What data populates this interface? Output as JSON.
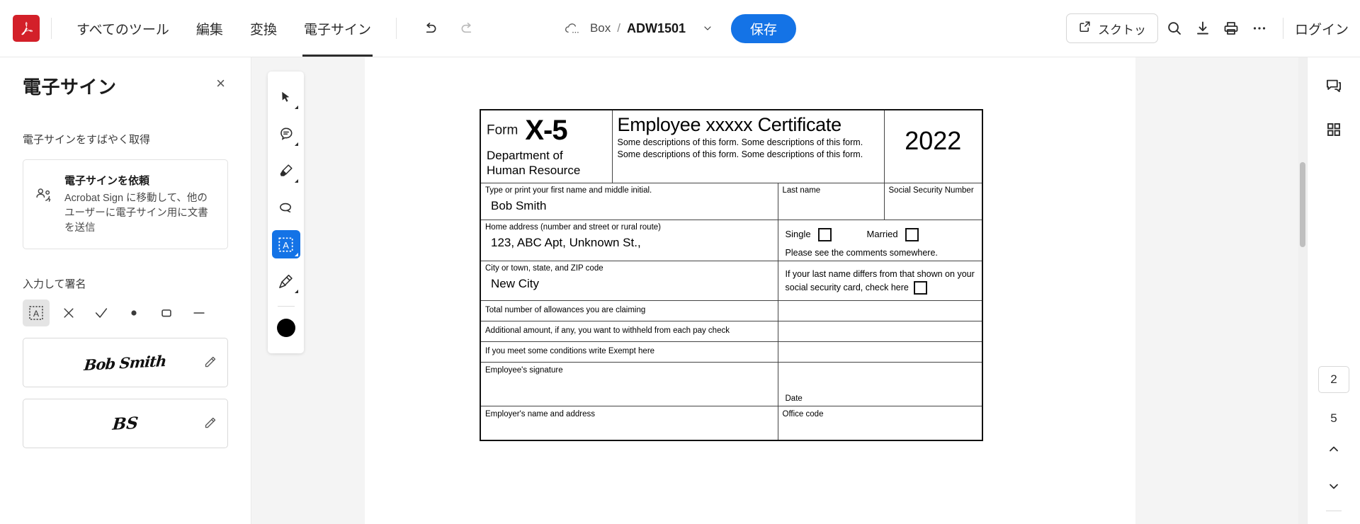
{
  "topbar": {
    "logo_alt": "adobe-acrobat-logo",
    "tabs": [
      {
        "label": "すべてのツール",
        "active": false
      },
      {
        "label": "編集",
        "active": false
      },
      {
        "label": "変換",
        "active": false
      },
      {
        "label": "電子サイン",
        "active": true
      }
    ],
    "undo_label": "undo",
    "redo_label": "redo",
    "file": {
      "location": "Box",
      "separator": "/",
      "name": "ADW1501"
    },
    "save_label": "保存",
    "screenshot_label": "スクトッ",
    "login_label": "ログイン",
    "accent_color": "#1473e6",
    "logo_color": "#d32029"
  },
  "left_panel": {
    "title": "電子サイン",
    "close_label": "×",
    "subtitle": "電子サインをすばやく取得",
    "request_card": {
      "title": "電子サインを依頼",
      "description": "Acrobat Sign に移動して、他のユーザーに電子サイン用に文書を送信"
    },
    "type_sign_label": "入力して署名",
    "stamp_tools": [
      {
        "name": "text-stamp",
        "glyph": "A",
        "selected": true
      },
      {
        "name": "cross-stamp",
        "glyph": "✕",
        "selected": false
      },
      {
        "name": "check-stamp",
        "glyph": "✓",
        "selected": false
      },
      {
        "name": "dot-stamp",
        "glyph": "●",
        "selected": false
      },
      {
        "name": "rect-stamp",
        "glyph": "▢",
        "selected": false
      },
      {
        "name": "line-stamp",
        "glyph": "—",
        "selected": false
      }
    ],
    "saved_signatures": [
      {
        "text": "Bob Smith",
        "kind": "full-signature"
      },
      {
        "text": "BS",
        "kind": "initials"
      }
    ]
  },
  "toolrail": {
    "items": [
      {
        "name": "select-tool",
        "active": false,
        "has_caret": true
      },
      {
        "name": "comment-tool",
        "active": false,
        "has_caret": true
      },
      {
        "name": "highlight-tool",
        "active": false,
        "has_caret": true
      },
      {
        "name": "lasso-tool",
        "active": false,
        "has_caret": false
      },
      {
        "name": "add-text-tool",
        "active": true,
        "has_caret": true
      },
      {
        "name": "draw-signature-tool",
        "active": false,
        "has_caret": true
      }
    ],
    "color_swatch": "#000000"
  },
  "right_rail": {
    "comment_icon": "comment-panel-icon",
    "thumbnails_icon": "page-thumbnails-icon",
    "current_page": "2",
    "total_pages": "5",
    "prev_label": "前のページ",
    "next_label": "次のページ"
  },
  "document": {
    "header": {
      "form_word": "Form",
      "form_number": "X-5",
      "department": "Department of\nHuman Resource",
      "certificate_title": "Employee xxxxx Certificate",
      "certificate_desc": "Some descriptions of this form. Some descriptions of this form. Some descriptions of this form. Some descriptions of this form.",
      "year": "2022"
    },
    "rows": {
      "first_name_label": "Type or print your first name and middle initial.",
      "first_name_value": "Bob Smith",
      "last_name_label": "Last name",
      "last_name_value": "",
      "ssn_label": "Social Security Number",
      "ssn_value": "",
      "home_address_label": "Home address (number and street or rural route)",
      "home_address_value": "123, ABC Apt, Unknown St.,",
      "single_label": "Single",
      "married_label": "Married",
      "comments_note": "Please see the comments somewhere.",
      "city_label": "City or town, state, and ZIP code",
      "city_value": "New City",
      "lastname_differs_note": "If your last name differs from that shown on your social security card, check here",
      "allowances_label": "Total number of allowances you are claiming",
      "allowances_value": "",
      "additional_label": "Additional amount, if any, you want to withheld from each pay check",
      "additional_value": "",
      "exempt_label": "If you meet some conditions write Exempt here",
      "exempt_value": "",
      "employee_sig_label": "Employee's signature",
      "date_label": "Date",
      "employer_label": "Employer's name and address",
      "office_code_label": "Office code"
    }
  }
}
